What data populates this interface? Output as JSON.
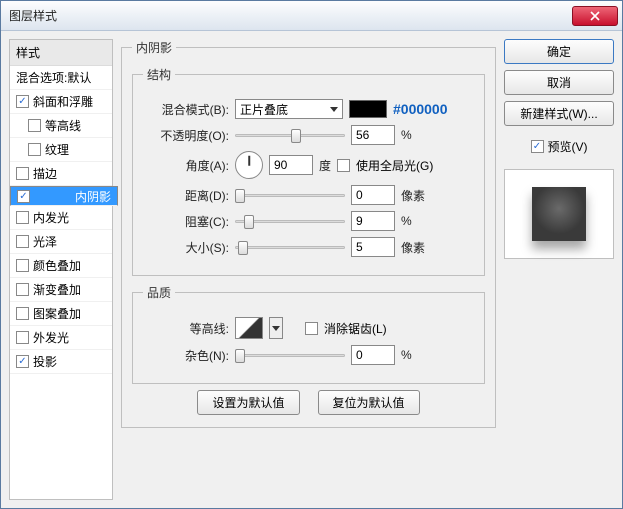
{
  "window": {
    "title": "图层样式"
  },
  "styleList": {
    "header": "样式",
    "blending": "混合选项:默认",
    "items": [
      {
        "label": "斜面和浮雕",
        "checked": true,
        "indent": false
      },
      {
        "label": "等高线",
        "checked": false,
        "indent": true
      },
      {
        "label": "纹理",
        "checked": false,
        "indent": true
      },
      {
        "label": "描边",
        "checked": false,
        "indent": false
      },
      {
        "label": "内阴影",
        "checked": true,
        "indent": false,
        "selected": true
      },
      {
        "label": "内发光",
        "checked": false,
        "indent": false
      },
      {
        "label": "光泽",
        "checked": false,
        "indent": false
      },
      {
        "label": "颜色叠加",
        "checked": false,
        "indent": false
      },
      {
        "label": "渐变叠加",
        "checked": false,
        "indent": false
      },
      {
        "label": "图案叠加",
        "checked": false,
        "indent": false
      },
      {
        "label": "外发光",
        "checked": false,
        "indent": false
      },
      {
        "label": "投影",
        "checked": true,
        "indent": false
      }
    ]
  },
  "panel": {
    "title": "内阴影",
    "structure": {
      "legend": "结构",
      "blendMode": {
        "label": "混合模式(B):",
        "value": "正片叠底",
        "hex": "#000000"
      },
      "opacity": {
        "label": "不透明度(O):",
        "value": "56",
        "unit": "%",
        "pct": 56
      },
      "angle": {
        "label": "角度(A):",
        "value": "90",
        "unit": "度",
        "globalLabel": "使用全局光(G)",
        "globalChecked": false
      },
      "distance": {
        "label": "距离(D):",
        "value": "0",
        "unit": "像素",
        "pct": 0
      },
      "choke": {
        "label": "阻塞(C):",
        "value": "9",
        "unit": "%",
        "pct": 9
      },
      "size": {
        "label": "大小(S):",
        "value": "5",
        "unit": "像素",
        "pct": 3
      }
    },
    "quality": {
      "legend": "品质",
      "contourLabel": "等高线:",
      "antiAliasLabel": "消除锯齿(L)",
      "antiAliasChecked": false,
      "noise": {
        "label": "杂色(N):",
        "value": "0",
        "unit": "%",
        "pct": 0
      }
    },
    "buttons": {
      "setDefault": "设置为默认值",
      "resetDefault": "复位为默认值"
    }
  },
  "right": {
    "ok": "确定",
    "cancel": "取消",
    "newStyle": "新建样式(W)...",
    "previewLabel": "预览(V)",
    "previewChecked": true
  }
}
